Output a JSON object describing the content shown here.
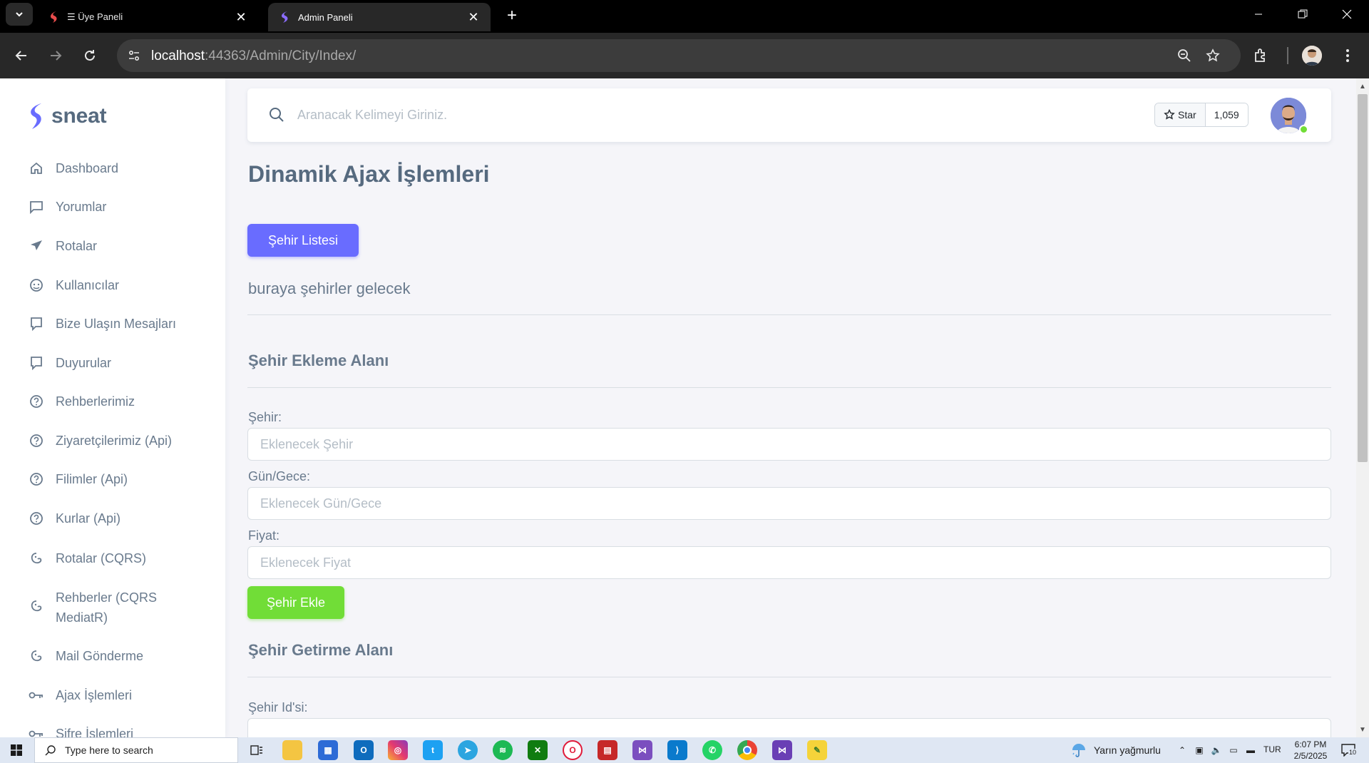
{
  "browser": {
    "tabs": [
      {
        "title": "☰ Üye Paneli",
        "active": false
      },
      {
        "title": "Admin Paneli",
        "active": true
      }
    ],
    "url_host": "localhost",
    "url_rest": ":44363/Admin/City/Index/"
  },
  "sidebar": {
    "brand": "sneat",
    "items": [
      {
        "label": "Dashboard",
        "icon": "home-icon"
      },
      {
        "label": "Yorumlar",
        "icon": "comment-icon"
      },
      {
        "label": "Rotalar",
        "icon": "plane-icon"
      },
      {
        "label": "Kullanıcılar",
        "icon": "user-face-icon"
      },
      {
        "label": "Bize Ulaşın Mesajları",
        "icon": "message-icon"
      },
      {
        "label": "Duyurular",
        "icon": "message-icon"
      },
      {
        "label": "Rehberlerimiz",
        "icon": "help-circle-icon"
      },
      {
        "label": "Ziyaretçilerimiz (Api)",
        "icon": "help-circle-icon"
      },
      {
        "label": "Filimler (Api)",
        "icon": "help-circle-icon"
      },
      {
        "label": "Kurlar (Api)",
        "icon": "help-circle-icon"
      },
      {
        "label": "Rotalar (CQRS)",
        "icon": "mailchimp-icon"
      },
      {
        "label": "Rehberler (CQRS MediatR)",
        "icon": "mailchimp-icon"
      },
      {
        "label": "Mail Gönderme",
        "icon": "mailchimp-icon"
      },
      {
        "label": "Ajax İşlemleri",
        "icon": "key-icon"
      },
      {
        "label": "Şifre İşlemleri",
        "icon": "key-icon"
      }
    ]
  },
  "navbar": {
    "search_placeholder": "Aranacak Kelimeyi Giriniz.",
    "star_label": "Star",
    "star_count": "1,059"
  },
  "main": {
    "title": "Dinamik Ajax İşlemleri",
    "city_list_button": "Şehir Listesi",
    "cities_placeholder": "buraya şehirler gelecek",
    "add_section_title": "Şehir Ekleme Alanı",
    "fields": [
      {
        "label": "Şehir:",
        "placeholder": "Eklenecek Şehir"
      },
      {
        "label": "Gün/Gece:",
        "placeholder": "Eklenecek Gün/Gece"
      },
      {
        "label": "Fiyat:",
        "placeholder": "Eklenecek Fiyat"
      }
    ],
    "add_button": "Şehir Ekle",
    "get_section_title": "Şehir Getirme Alanı",
    "city_id_label": "Şehir Id'si:"
  },
  "colors": {
    "primary": "#696cff",
    "success": "#71dd37",
    "text": "#697a8d",
    "heading": "#566a7f"
  },
  "taskbar": {
    "search_placeholder": "Type here to search",
    "weather": "Yarın yağmurlu",
    "language": "TUR",
    "time": "6:07 PM",
    "date": "2/5/2025",
    "notification_count": "10"
  }
}
